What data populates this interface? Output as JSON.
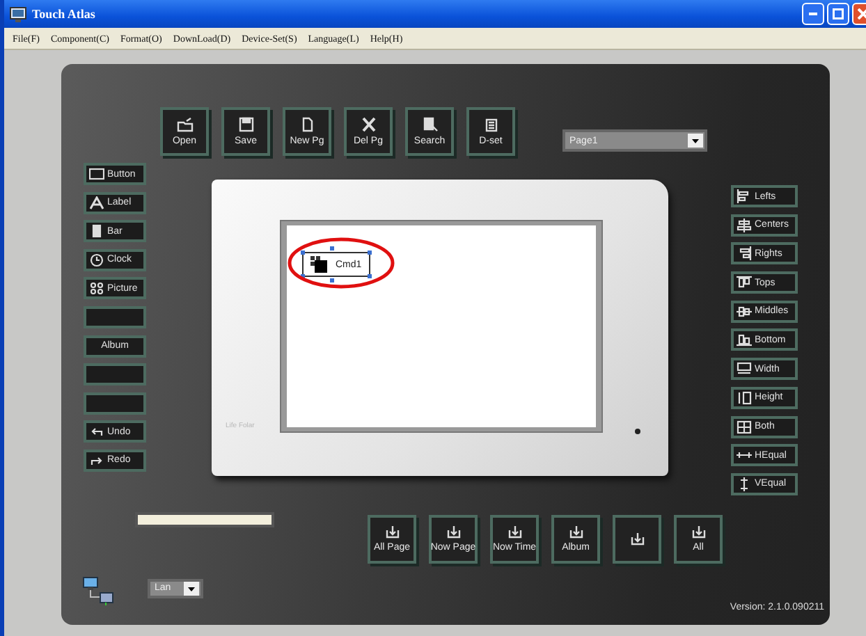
{
  "window": {
    "title": "Touch Atlas"
  },
  "menu": [
    "File(F)",
    "Component(C)",
    "Format(O)",
    "DownLoad(D)",
    "Device-Set(S)",
    "Language(L)",
    "Help(H)"
  ],
  "toolbar": [
    {
      "label": "Open"
    },
    {
      "label": "Save"
    },
    {
      "label": "New Pg"
    },
    {
      "label": "Del Pg"
    },
    {
      "label": "Search"
    },
    {
      "label": "D-set"
    }
  ],
  "page_select": {
    "value": "Page1"
  },
  "components": [
    {
      "kind": "item",
      "label": "Button"
    },
    {
      "kind": "item",
      "label": "Label"
    },
    {
      "kind": "item",
      "label": "Bar"
    },
    {
      "kind": "item",
      "label": "Clock"
    },
    {
      "kind": "item",
      "label": "Picture"
    },
    {
      "kind": "blank"
    },
    {
      "kind": "item",
      "label": "Album"
    },
    {
      "kind": "blank"
    },
    {
      "kind": "blank"
    },
    {
      "kind": "item",
      "label": "Undo"
    },
    {
      "kind": "item",
      "label": "Redo"
    }
  ],
  "device": {
    "brand": "Life Folar",
    "screen_items": [
      {
        "label": "Cmd1",
        "selected": true,
        "highlighted": true
      }
    ]
  },
  "align": [
    {
      "label": "Lefts"
    },
    {
      "label": "Centers"
    },
    {
      "label": "Rights"
    },
    {
      "label": "Tops"
    },
    {
      "label": "Middles"
    },
    {
      "label": "Bottom"
    },
    {
      "label": "Width"
    },
    {
      "label": "Height"
    },
    {
      "label": "Both"
    },
    {
      "label": "HEqual"
    },
    {
      "label": "VEqual"
    }
  ],
  "progress": {
    "level": 1
  },
  "download": [
    {
      "kind": "item",
      "label": "All Page"
    },
    {
      "kind": "item",
      "label": "Now Page"
    },
    {
      "kind": "item",
      "label": "Now Time"
    },
    {
      "kind": "item",
      "label": "Album"
    },
    {
      "kind": "blank"
    },
    {
      "kind": "item",
      "label": "All"
    }
  ],
  "connection": {
    "value": "Lan"
  },
  "version": "Version: 2.1.0.090211"
}
